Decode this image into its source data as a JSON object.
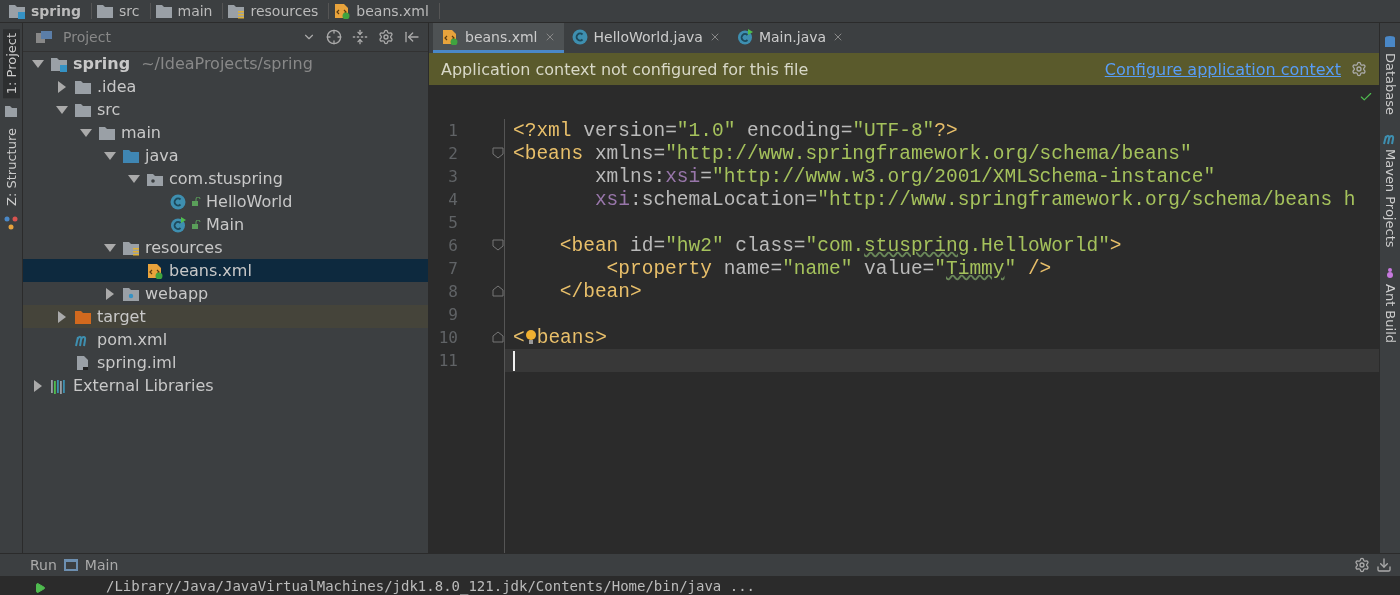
{
  "breadcrumbs": [
    {
      "kind": "module",
      "label": "spring"
    },
    {
      "kind": "folder",
      "label": "src"
    },
    {
      "kind": "folder",
      "label": "main"
    },
    {
      "kind": "resources",
      "label": "resources"
    },
    {
      "kind": "xml",
      "label": "beans.xml"
    }
  ],
  "left_tool_windows": [
    {
      "kind": "project",
      "label": "1: Project",
      "selected": true
    },
    {
      "kind": "structure",
      "label": "Z: Structure",
      "selected": false
    }
  ],
  "project_panel": {
    "title": "Project"
  },
  "tree": [
    {
      "kind": "module",
      "label": "spring",
      "path": "~/IdeaProjects/spring",
      "expanded": true,
      "selected": false,
      "children": [
        {
          "kind": "folder",
          "label": ".idea",
          "expanded": false,
          "selected": false
        },
        {
          "kind": "folder",
          "label": "src",
          "expanded": true,
          "selected": false,
          "children": [
            {
              "kind": "folder",
              "label": "main",
              "expanded": true,
              "selected": false,
              "children": [
                {
                  "kind": "source",
                  "label": "java",
                  "expanded": true,
                  "selected": false,
                  "children": [
                    {
                      "kind": "package",
                      "label": "com.stuspring",
                      "expanded": true,
                      "selected": false,
                      "children": [
                        {
                          "kind": "class",
                          "label": "HelloWorld",
                          "selected": false
                        },
                        {
                          "kind": "main-class",
                          "label": "Main",
                          "selected": false
                        }
                      ]
                    }
                  ]
                },
                {
                  "kind": "resources",
                  "label": "resources",
                  "expanded": true,
                  "selected": false,
                  "children": [
                    {
                      "kind": "xml",
                      "label": "beans.xml",
                      "selected": true
                    }
                  ]
                },
                {
                  "kind": "web",
                  "label": "webapp",
                  "expanded": false,
                  "selected": false
                }
              ]
            }
          ]
        },
        {
          "kind": "excluded",
          "label": "target",
          "expanded": false,
          "selected": false
        },
        {
          "kind": "maven",
          "label": "pom.xml",
          "selected": false
        },
        {
          "kind": "iml",
          "label": "spring.iml",
          "selected": false
        }
      ]
    },
    {
      "kind": "libraries",
      "label": "External Libraries",
      "expanded": false,
      "selected": false
    }
  ],
  "tabs": [
    {
      "kind": "xml",
      "label": "beans.xml",
      "selected": true
    },
    {
      "kind": "class",
      "label": "HelloWorld.java",
      "selected": false
    },
    {
      "kind": "main-class",
      "label": "Main.java",
      "selected": false
    }
  ],
  "notification": {
    "message": "Application context not configured for this file",
    "link": "Configure application context"
  },
  "code_lines": [
    {
      "number": "1",
      "fold_start": false,
      "fold_end": false,
      "current": false,
      "segments": [
        {
          "kind": "tag",
          "text": "<?xml "
        },
        {
          "kind": "attr",
          "text": "version="
        },
        {
          "kind": "value",
          "text": "\"1.0\""
        },
        {
          "kind": "attr",
          "text": " encoding="
        },
        {
          "kind": "value",
          "text": "\"UTF-8\""
        },
        {
          "kind": "tag",
          "text": "?>"
        }
      ]
    },
    {
      "number": "2",
      "fold_start": true,
      "fold_end": false,
      "current": false,
      "segments": [
        {
          "kind": "tag",
          "text": "<beans "
        },
        {
          "kind": "attr",
          "text": "xmlns="
        },
        {
          "kind": "value",
          "text": "\"http://www.springframework.org/schema/beans\""
        }
      ]
    },
    {
      "number": "3",
      "fold_start": false,
      "fold_end": false,
      "current": false,
      "segments": [
        {
          "kind": "attr",
          "text": "       xmlns:"
        },
        {
          "kind": "ns",
          "text": "xsi"
        },
        {
          "kind": "attr",
          "text": "="
        },
        {
          "kind": "value",
          "text": "\"http://www.w3.org/2001/XMLSchema-instance\""
        }
      ]
    },
    {
      "number": "4",
      "fold_start": false,
      "fold_end": false,
      "current": false,
      "segments": [
        {
          "kind": "ns",
          "text": "       xsi"
        },
        {
          "kind": "attr",
          "text": ":schemaLocation="
        },
        {
          "kind": "value",
          "text": "\"http://www.springframework.org/schema/beans h"
        }
      ]
    },
    {
      "number": "5",
      "fold_start": false,
      "fold_end": false,
      "current": false
    },
    {
      "number": "6",
      "fold_start": true,
      "fold_end": false,
      "current": false,
      "segments": [
        {
          "kind": "tag",
          "text": "    <bean "
        },
        {
          "kind": "attr",
          "text": "id="
        },
        {
          "kind": "value",
          "text": "\"hw2\""
        },
        {
          "kind": "attr",
          "text": " class="
        },
        {
          "kind": "value",
          "text": "\"com."
        },
        {
          "kind": "typo",
          "text": "stuspring"
        },
        {
          "kind": "value",
          "text": ".HelloWorld\""
        },
        {
          "kind": "tag",
          "text": ">"
        }
      ]
    },
    {
      "number": "7",
      "fold_start": false,
      "fold_end": false,
      "current": false,
      "segments": [
        {
          "kind": "tag",
          "text": "        <property "
        },
        {
          "kind": "attr",
          "text": "name="
        },
        {
          "kind": "value",
          "text": "\"name\""
        },
        {
          "kind": "attr",
          "text": " value="
        },
        {
          "kind": "value",
          "text": "\""
        },
        {
          "kind": "typo",
          "text": "Timmy"
        },
        {
          "kind": "value",
          "text": "\""
        },
        {
          "kind": "tag",
          "text": " />"
        }
      ]
    },
    {
      "number": "8",
      "fold_start": false,
      "fold_end": true,
      "current": false,
      "segments": [
        {
          "kind": "tag",
          "text": "    </bean>"
        }
      ]
    },
    {
      "number": "9",
      "fold_start": false,
      "fold_end": false,
      "current": false
    },
    {
      "number": "10",
      "fold_start": false,
      "fold_end": true,
      "current": false,
      "segments": [
        {
          "kind": "tag",
          "text": "<"
        },
        {
          "kind": "bulb"
        },
        {
          "kind": "tag",
          "text": "beans>"
        }
      ]
    },
    {
      "number": "11",
      "fold_start": false,
      "fold_end": false,
      "current": true
    }
  ],
  "right_tool_windows": [
    {
      "kind": "database",
      "label": "Database"
    },
    {
      "kind": "maven",
      "label": "Maven Projects"
    },
    {
      "kind": "ant",
      "label": "Ant Build"
    }
  ],
  "run_bar": {
    "title": "Run",
    "config": "Main"
  },
  "console_line": "/Library/Java/JavaVirtualMachines/jdk1.8.0_121.jdk/Contents/Home/bin/java ..."
}
